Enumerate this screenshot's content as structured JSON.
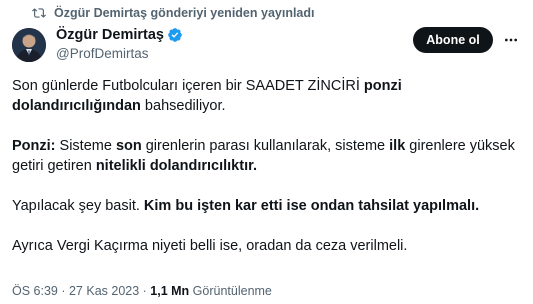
{
  "repost": {
    "icon": "repost-icon",
    "text": "Özgür Demirtaş gönderiyi yeniden yayınladı"
  },
  "author": {
    "display_name": "Özgür Demirtaş",
    "handle": "@ProfDemirtas",
    "verified_icon": "verified-badge-icon",
    "verified_color": "#1d9bf0"
  },
  "actions": {
    "follow_label": "Abone ol",
    "more_icon": "more-icon"
  },
  "tweet": {
    "p1_a": "Son günlerde Futbolcuları içeren bir SAADET ZİNCİRİ ",
    "p1_b": "ponzi dolandırıcılığından",
    "p1_c": " bahsediliyor.",
    "p2_a": "Ponzi:",
    "p2_b": " Sisteme ",
    "p2_c": "son",
    "p2_d": " girenlerin parası kullanılarak, sisteme ",
    "p2_e": "ilk",
    "p2_f": " girenlere yüksek getiri getiren ",
    "p2_g": "nitelikli dolandırıcılıktır.",
    "p3_a": "Yapılacak şey basit. ",
    "p3_b": "Kim bu işten kar etti ise ondan tahsilat yapılmalı.",
    "p4": "Ayrıca Vergi Kaçırma niyeti belli ise, oradan da ceza verilmeli."
  },
  "meta": {
    "time": "ÖS 6:39",
    "sep1": " · ",
    "date": "27 Kas 2023",
    "sep2": " · ",
    "views_count": "1,1 Mn",
    "views_label": " Görüntülenme"
  },
  "colors": {
    "text": "#0f1419",
    "secondary": "#536471",
    "button_bg": "#0f1419",
    "button_text": "#ffffff"
  }
}
